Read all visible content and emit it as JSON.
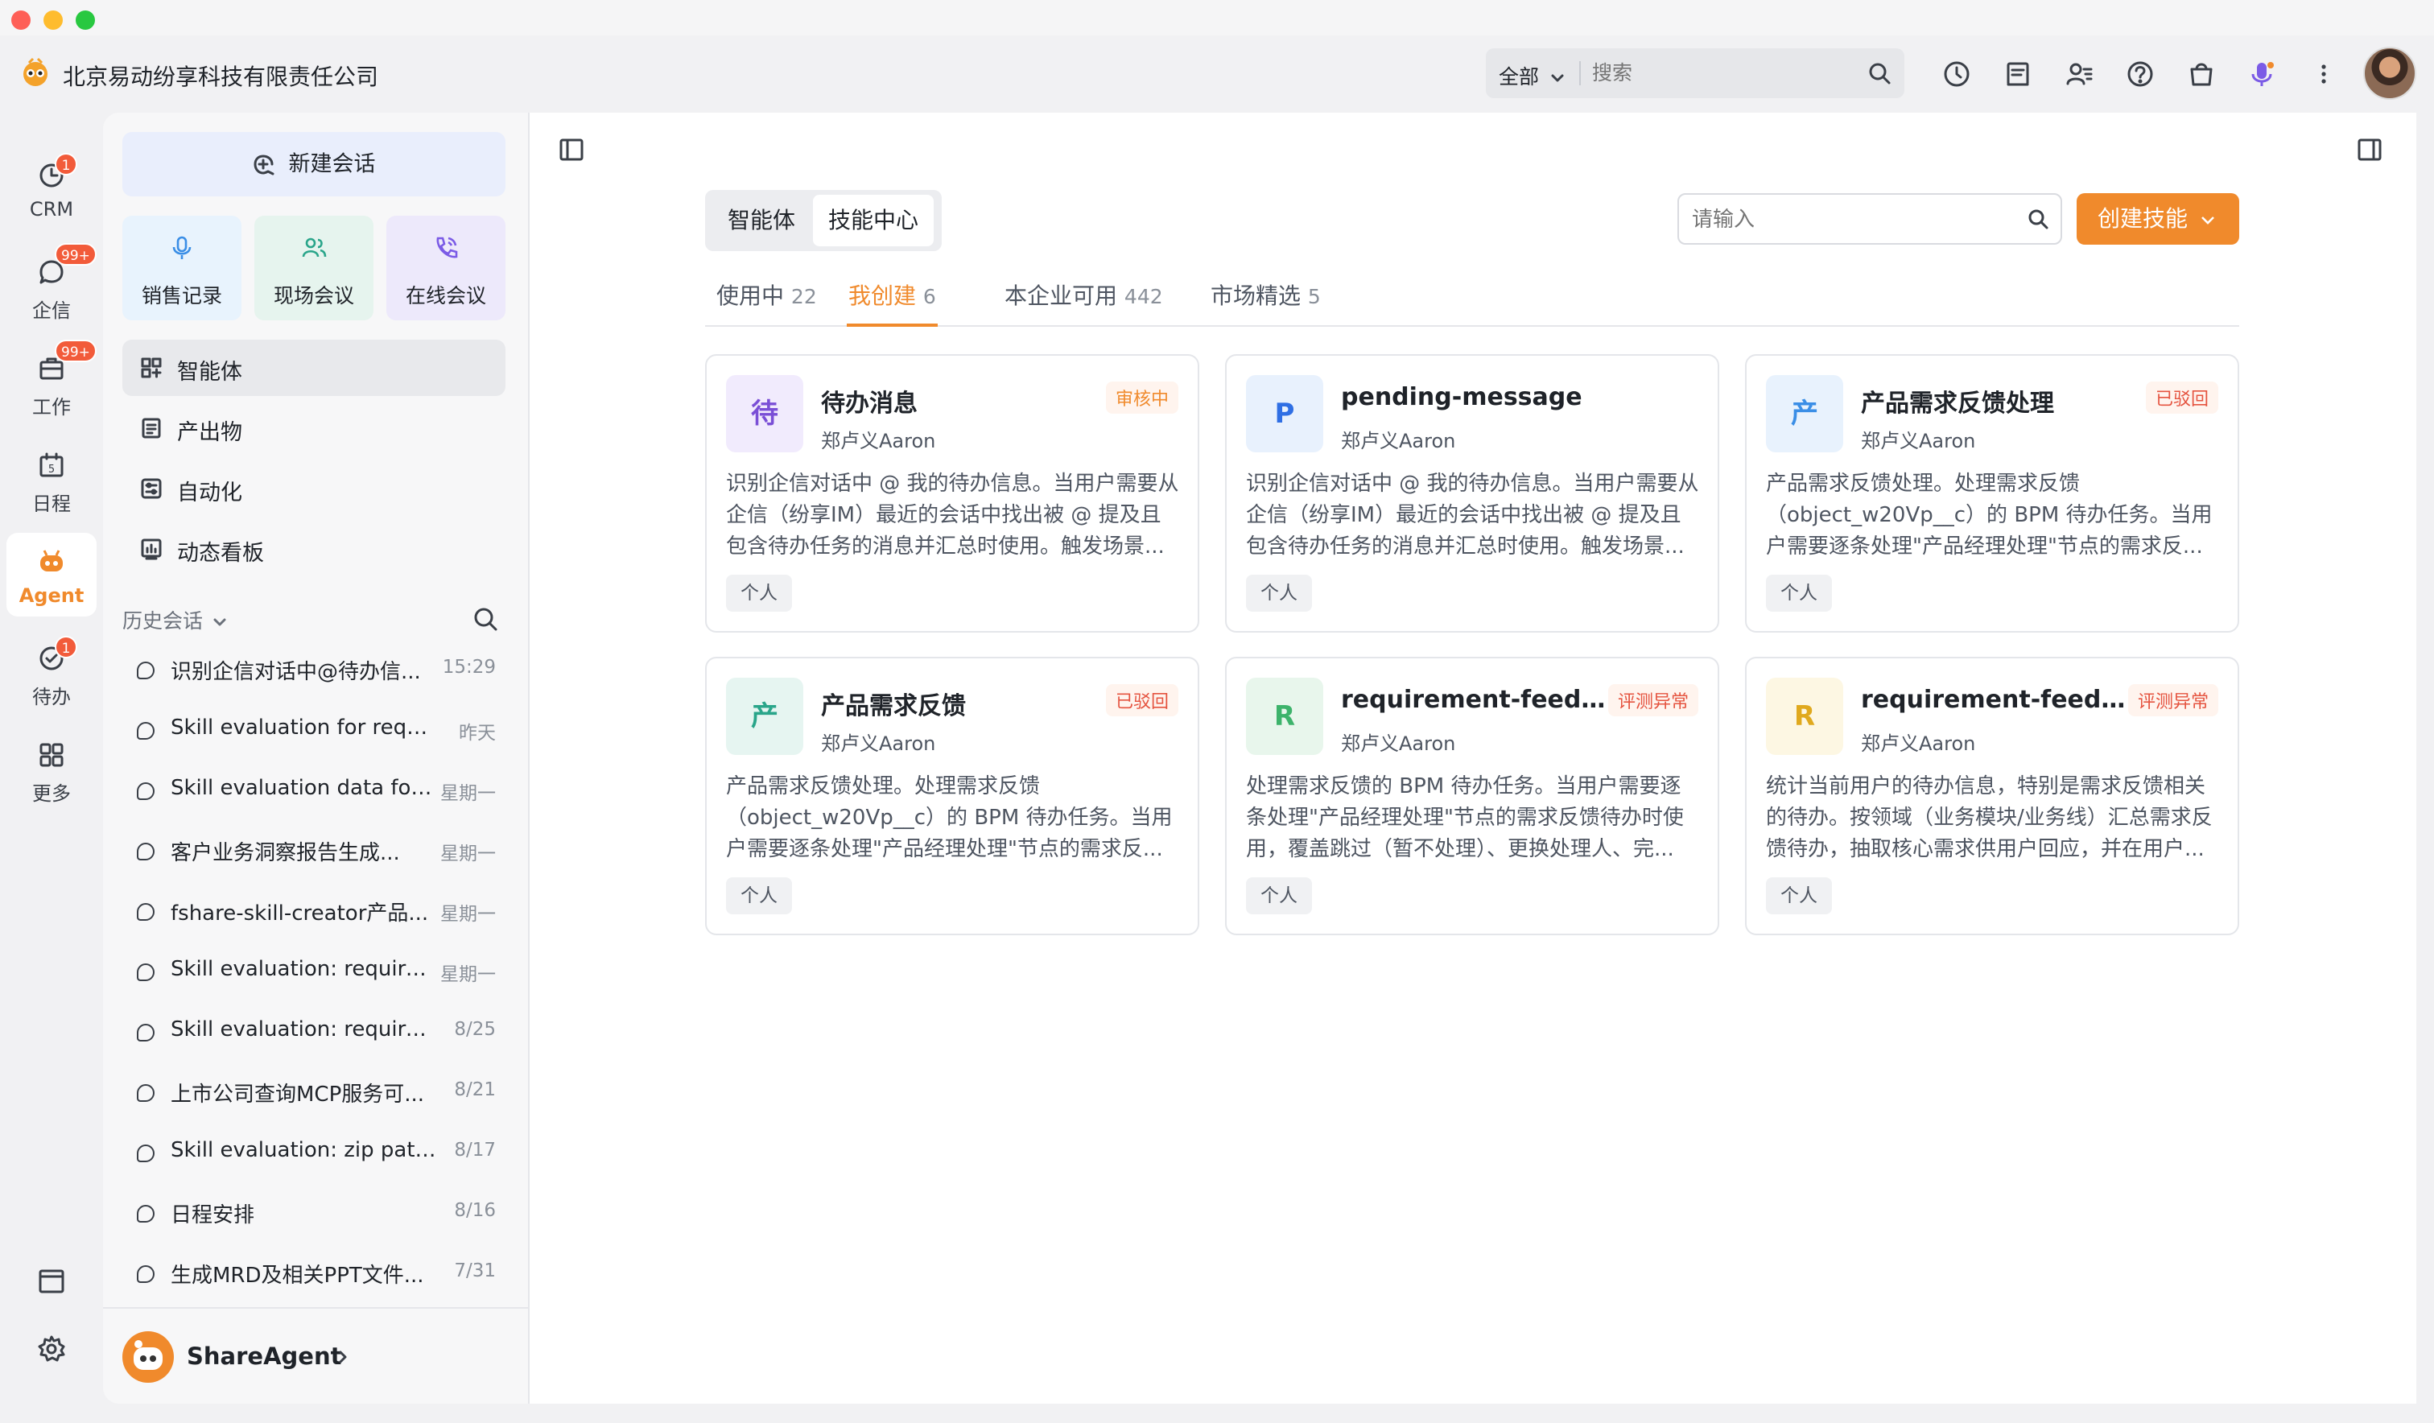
{
  "app": {
    "company": "北京易动纷享科技有限责任公司"
  },
  "header": {
    "scope": "全部",
    "search_placeholder": "搜索"
  },
  "rail": {
    "items": [
      {
        "label": "CRM",
        "badge": "1"
      },
      {
        "label": "企信",
        "badge": "99+"
      },
      {
        "label": "工作",
        "badge": "99+"
      },
      {
        "label": "日程",
        "badge": ""
      },
      {
        "label": "Agent",
        "badge": ""
      },
      {
        "label": "待办",
        "badge": "1"
      },
      {
        "label": "更多",
        "badge": ""
      }
    ]
  },
  "sidebar": {
    "new_chat": "新建会话",
    "quick": [
      {
        "label": "销售记录",
        "color": "#e8f3fd"
      },
      {
        "label": "现场会议",
        "color": "#e6f4ee"
      },
      {
        "label": "在线会议",
        "color": "#ede9fb"
      }
    ],
    "nav": [
      "智能体",
      "产出物",
      "自动化",
      "动态看板"
    ],
    "history_title": "历史会话",
    "history": [
      {
        "title": "识别企信对话中@待办信...",
        "date": "15:29"
      },
      {
        "title": "Skill evaluation for require...",
        "date": "昨天"
      },
      {
        "title": "Skill evaluation data for ...",
        "date": "星期一"
      },
      {
        "title": "客户业务洞察报告生成...",
        "date": "星期一"
      },
      {
        "title": "fshare-skill-creator产品...",
        "date": "星期一"
      },
      {
        "title": "Skill evaluation: require...",
        "date": "星期一"
      },
      {
        "title": "Skill evaluation: requireme...",
        "date": "8/25"
      },
      {
        "title": "上市公司查询MCP服务可...",
        "date": "8/21"
      },
      {
        "title": "Skill evaluation: zip path a...",
        "date": "8/17"
      },
      {
        "title": "日程安排",
        "date": "8/16"
      },
      {
        "title": "生成MRD及相关PPT文件...",
        "date": "7/31"
      }
    ],
    "user": "ShareAgent"
  },
  "main": {
    "seg": [
      "智能体",
      "技能中心"
    ],
    "search_placeholder": "请输入",
    "create_label": "创建技能",
    "tabs": [
      {
        "label": "使用中",
        "count": "22"
      },
      {
        "label": "我创建",
        "count": "6"
      },
      {
        "label": "本企业可用",
        "count": "442"
      },
      {
        "label": "市场精选",
        "count": "5"
      }
    ],
    "cards": [
      {
        "avatar": "待",
        "name": "待办消息",
        "author": "郑卢义Aaron",
        "status": "审核中",
        "status_color": "#f08a2c",
        "av_bg": "#f1ebfd",
        "av_fg": "#7a4fd6",
        "desc": "识别企信对话中 @ 我的待办信息。当用户需要从企信（纷享IM）最近的会话中找出被 @ 提及且包含待办任务的消息并汇总时使用。触发场景...",
        "tag": "个人"
      },
      {
        "avatar": "P",
        "name": "pending-message",
        "author": "郑卢义Aaron",
        "status": "",
        "status_color": "",
        "av_bg": "#e8f1fd",
        "av_fg": "#2f6fe4",
        "desc": "识别企信对话中 @ 我的待办信息。当用户需要从企信（纷享IM）最近的会话中找出被 @ 提及且包含待办任务的消息并汇总时使用。触发场景...",
        "tag": "个人"
      },
      {
        "avatar": "产",
        "name": "产品需求反馈处理",
        "author": "郑卢义Aaron",
        "status": "已驳回",
        "status_color": "#e5533f",
        "av_bg": "#e8f2fd",
        "av_fg": "#3a8ee6",
        "desc": "产品需求反馈处理。处理需求反馈（object_w20Vp__c）的 BPM 待办任务。当用户需要逐条处理\"产品经理处理\"节点的需求反...",
        "tag": "个人"
      },
      {
        "avatar": "产",
        "name": "产品需求反馈",
        "author": "郑卢义Aaron",
        "status": "已驳回",
        "status_color": "#e5533f",
        "av_bg": "#e6f5f1",
        "av_fg": "#2aa58a",
        "desc": "产品需求反馈处理。处理需求反馈（object_w20Vp__c）的 BPM 待办任务。当用户需要逐条处理\"产品经理处理\"节点的需求反...",
        "tag": "个人"
      },
      {
        "avatar": "R",
        "name": "requirement-feedba...",
        "author": "郑卢义Aaron",
        "status": "评测异常",
        "status_color": "#e5533f",
        "av_bg": "#e8f6ec",
        "av_fg": "#3db36b",
        "desc": "处理需求反馈的 BPM 待办任务。当用户需要逐条处理\"产品经理处理\"节点的需求反馈待办时使用，覆盖跳过（暂不处理）、更换处理人、完...",
        "tag": "个人"
      },
      {
        "avatar": "R",
        "name": "requirement-feedba...",
        "author": "郑卢义Aaron",
        "status": "评测异常",
        "status_color": "#e5533f",
        "av_bg": "#fdf7e3",
        "av_fg": "#e0a91e",
        "desc": "统计当前用户的待办信息，特别是需求反馈相关的待办。按领域（业务模块/业务线）汇总需求反馈待办，抽取核心需求供用户回应，并在用户...",
        "tag": "个人"
      }
    ]
  }
}
